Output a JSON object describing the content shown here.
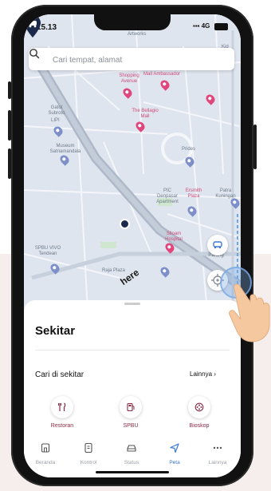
{
  "status_bar": {
    "time": "15.13",
    "network": "4G"
  },
  "search": {
    "placeholder": "Cari tempat, alamat"
  },
  "map": {
    "labels": {
      "artworks": "Artworks",
      "kid": "Kid",
      "shopping_avenue": "Shopping Avenue",
      "mall_ambassador": "Mall Ambassador",
      "the_bellagio_mall": "The Bellagio Mall",
      "gatot_subroto": "Gatot Subroto",
      "lipi": "LIPI",
      "museum_satriamandala": "Museum Satriamandala",
      "prides": "Prides",
      "pic_denpasar": "PIC Denpasar Apartment",
      "ersmith": "Ersmith Plaza",
      "patra_kuningan": "Patra Kuningan",
      "spbu_vivo": "SPBU VIVO Tendean",
      "rs_siloam": "Siloam Hospital",
      "tegal_parang": "Tegal Parang",
      "raja_plaza": "Raja Plaza",
      "here": "here"
    }
  },
  "sheet": {
    "title": "Sekitar",
    "nearby_label": "Cari di sekitar",
    "more_label": "Lainnya ›",
    "categories": [
      {
        "label": "Restoran",
        "icon": "fork-knife-icon"
      },
      {
        "label": "SPBU",
        "icon": "fuel-pump-icon"
      },
      {
        "label": "Bioskop",
        "icon": "film-reel-icon"
      }
    ]
  },
  "tabs": [
    {
      "label": "Beranda",
      "icon": "home-icon"
    },
    {
      "label": "Kontrol",
      "icon": "remote-icon"
    },
    {
      "label": "Status",
      "icon": "car-icon"
    },
    {
      "label": "Peta",
      "icon": "navigation-arrow-icon",
      "active": true
    },
    {
      "label": "Lainnya",
      "icon": "more-dots-icon"
    }
  ],
  "colors": {
    "accent": "#3b78d8",
    "category_text": "#8a2a44",
    "poi_pink": "#e0457b",
    "pin_navy": "#1b2a4a"
  }
}
